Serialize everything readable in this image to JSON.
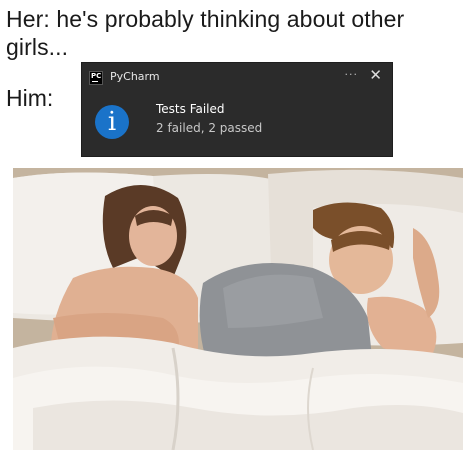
{
  "meme": {
    "caption_her": "Her: he's probably thinking about other girls...",
    "caption_him": "Him:"
  },
  "notification": {
    "app_name": "PyCharm",
    "app_icon": "PC",
    "more_label": "···",
    "close_label": "✕",
    "info_glyph": "i",
    "title": "Tests Failed",
    "body": "2 failed, 2 passed",
    "colors": {
      "background": "#2b2b2b",
      "info_accent": "#1a73c9"
    }
  },
  "photo": {
    "icon": "couple-in-bed-photo"
  }
}
